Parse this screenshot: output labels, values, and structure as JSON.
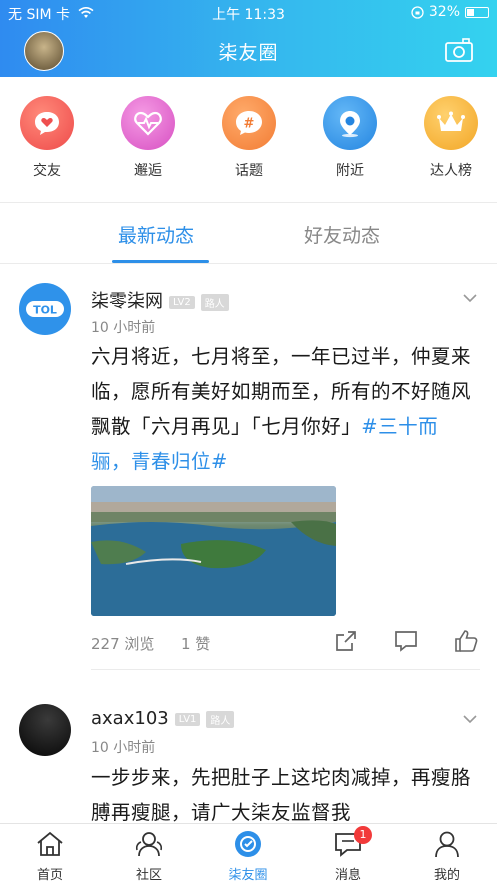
{
  "status_bar": {
    "carrier": "无 SIM 卡",
    "time": "上午 11:33",
    "battery": "32%"
  },
  "header": {
    "title": "柒友圈"
  },
  "shortcuts": [
    {
      "label": "交友",
      "color": "#f25c5c",
      "icon": "heart-chat-icon"
    },
    {
      "label": "邂逅",
      "color": "#e564c9",
      "icon": "heartbeat-icon"
    },
    {
      "label": "话题",
      "color": "#f58a43",
      "icon": "hashtag-icon"
    },
    {
      "label": "附近",
      "color": "#2f93e8",
      "icon": "location-pin-icon"
    },
    {
      "label": "达人榜",
      "color": "#f5b63f",
      "icon": "crown-icon"
    }
  ],
  "tabs": {
    "latest": "最新动态",
    "friends": "好友动态"
  },
  "posts": [
    {
      "name": "柒零柒网",
      "level": "LV2",
      "role": "路人",
      "time": "10 小时前",
      "text_before_tag": "六月将近，七月将至，一年已过半，仲夏来临，愿所有美好如期而至，所有的不好随风飘散「六月再见」「七月你好」",
      "tag": "#三十而骊，青春归位#",
      "views": "227 浏览",
      "likes": "1 赞",
      "avatar_text": "TOL"
    },
    {
      "name": "axax103",
      "level": "LV1",
      "role": "路人",
      "time": "10 小时前",
      "text": "一步步来，先把肚子上这坨肉减掉，再瘦胳膊再瘦腿，请广大柒友监督我"
    }
  ],
  "bottom_nav": [
    {
      "label": "首页",
      "icon": "home-icon"
    },
    {
      "label": "社区",
      "icon": "community-icon"
    },
    {
      "label": "柒友圈",
      "icon": "moments-icon"
    },
    {
      "label": "消息",
      "icon": "message-icon",
      "badge": "1"
    },
    {
      "label": "我的",
      "icon": "profile-icon"
    }
  ],
  "colors": {
    "accent": "#2d8fe8",
    "badge_red": "#f23a3a"
  }
}
